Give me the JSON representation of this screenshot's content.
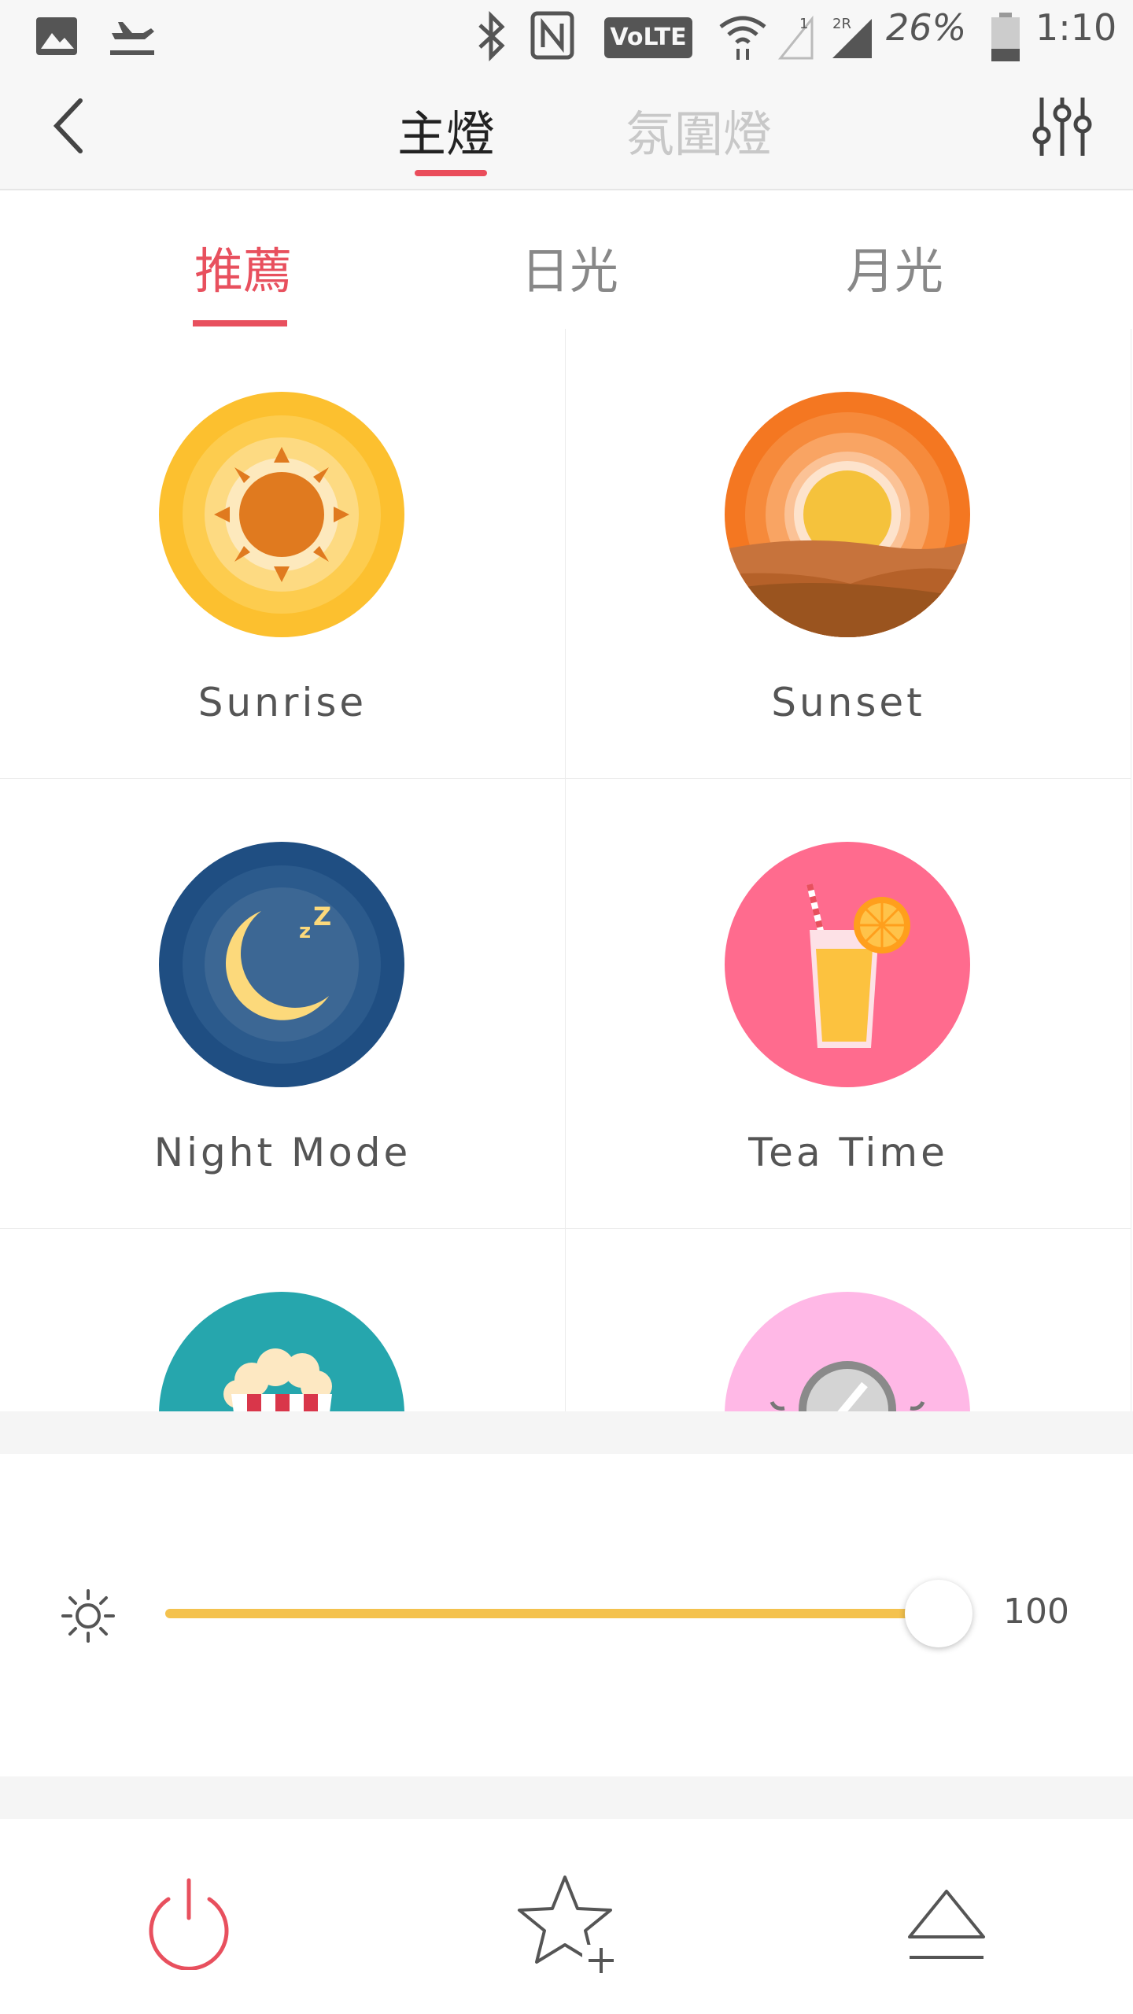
{
  "status_bar": {
    "battery": "26%",
    "time": "1:10",
    "volte": "VoLTE",
    "sim2": "2R"
  },
  "header": {
    "tabs": [
      {
        "label": "主燈",
        "active": true
      },
      {
        "label": "氛圍燈",
        "active": false
      }
    ]
  },
  "subtabs": [
    {
      "label": "推薦",
      "active": true
    },
    {
      "label": "日光",
      "active": false
    },
    {
      "label": "月光",
      "active": false
    }
  ],
  "scenes": [
    {
      "label": "Sunrise",
      "icon": "sunrise-icon"
    },
    {
      "label": "Sunset",
      "icon": "sunset-icon"
    },
    {
      "label": "Night Mode",
      "icon": "night-mode-icon"
    },
    {
      "label": "Tea Time",
      "icon": "tea-time-icon"
    },
    {
      "label": "",
      "icon": "popcorn-icon"
    },
    {
      "label": "",
      "icon": "mirror-icon"
    }
  ],
  "brightness": {
    "value": "100",
    "level_percent": 100
  },
  "colors": {
    "accent": "#e8505e",
    "slider": "#f4c24e"
  }
}
